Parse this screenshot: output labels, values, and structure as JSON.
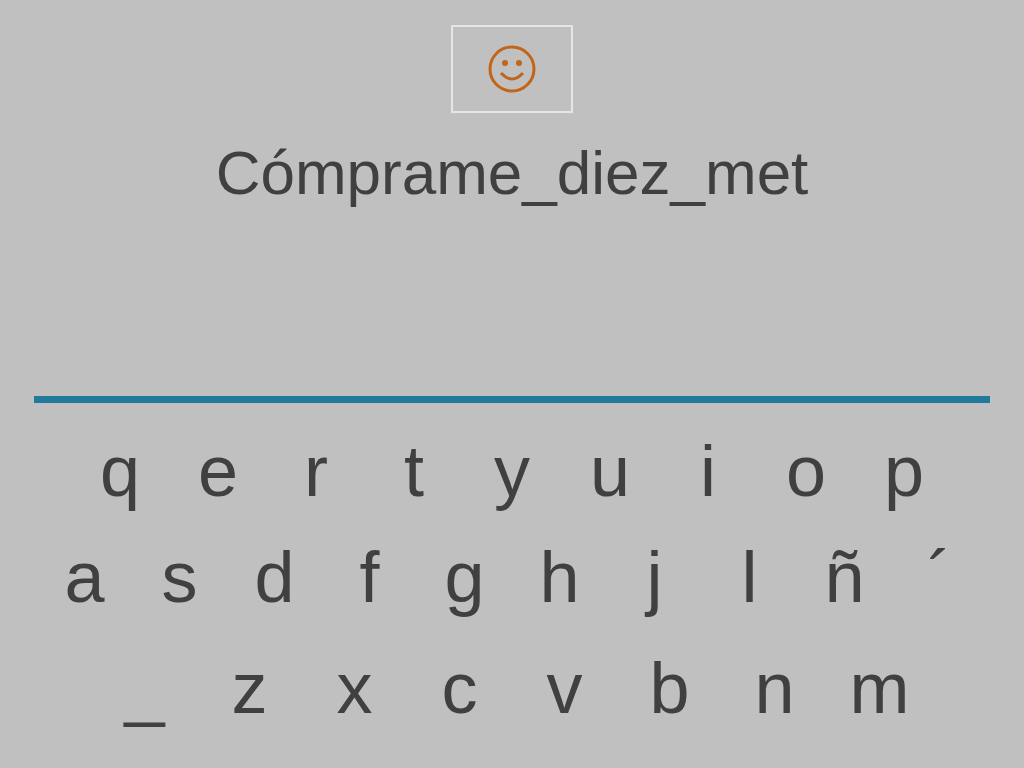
{
  "word": "Cómprame_diez_met",
  "keyboard": {
    "rows": [
      [
        "q",
        "e",
        "r",
        "t",
        "y",
        "u",
        "i",
        "o",
        "p"
      ],
      [
        "a",
        "s",
        "d",
        "f",
        "g",
        "h",
        "j",
        "l",
        "ñ",
        "´"
      ],
      [
        "_",
        "z",
        "x",
        "c",
        "v",
        "b",
        "n",
        "m"
      ]
    ]
  }
}
